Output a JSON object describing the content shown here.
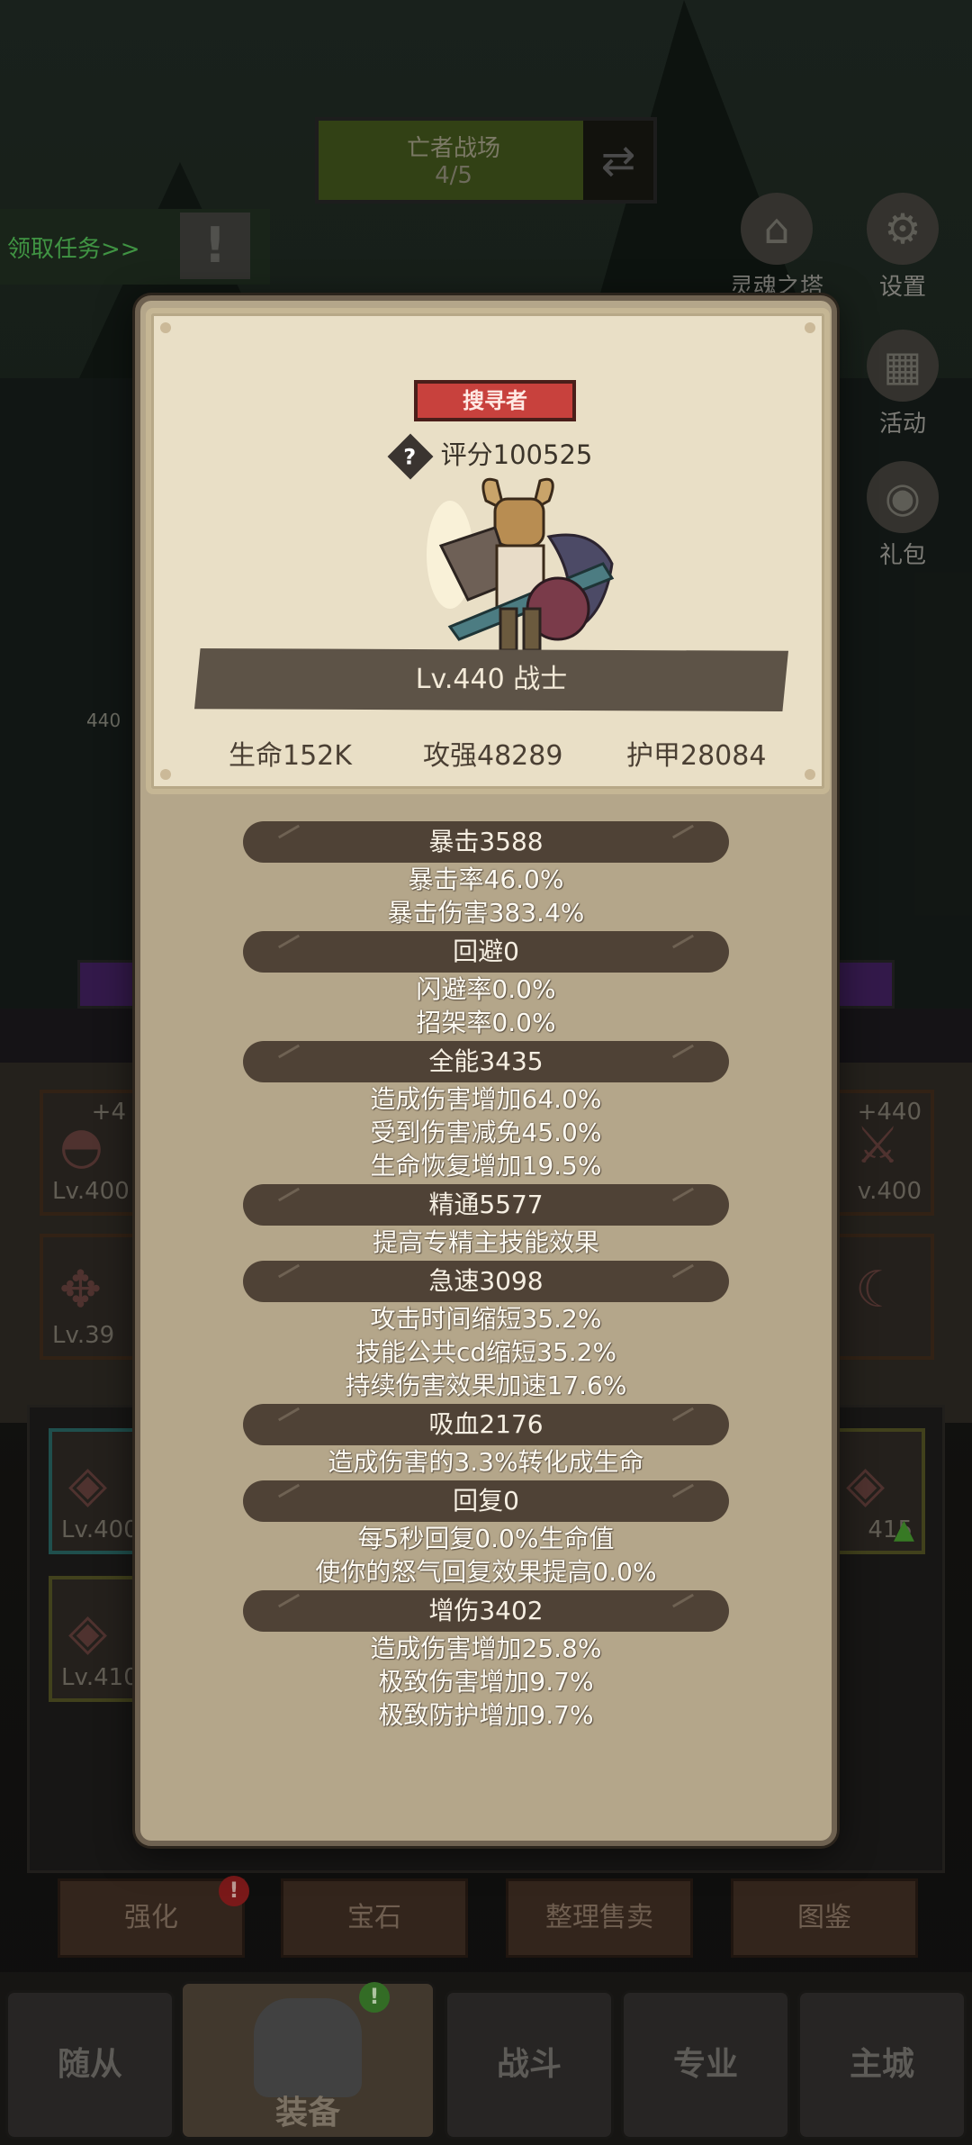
{
  "background": {
    "battle_title": "亡者战场",
    "battle_progress": "4/5",
    "quest_link": "领取任务>>",
    "side_buttons": [
      {
        "label": "灵魂之塔",
        "icon": "tower-icon"
      },
      {
        "label": "设置",
        "icon": "gear-icon"
      },
      {
        "label": "活动",
        "icon": "calendar-icon"
      },
      {
        "label": "礼包",
        "icon": "gift-icon"
      }
    ],
    "left_badge_level": "440",
    "equipment_left": [
      {
        "plus": "+4",
        "level": "Lv.400"
      },
      {
        "plus": "",
        "level": "Lv.39"
      }
    ],
    "equipment_right": [
      {
        "plus": "+440",
        "level": "v.400"
      }
    ],
    "bag_left": [
      {
        "level": "Lv.400"
      },
      {
        "level": "Lv.410"
      }
    ],
    "bag_right": [
      {
        "level": "415"
      }
    ],
    "actions": [
      {
        "label": "强化",
        "badge": "!"
      },
      {
        "label": "宝石"
      },
      {
        "label": "整理售卖"
      },
      {
        "label": "图鉴"
      }
    ],
    "tabs": [
      {
        "label": "随从"
      },
      {
        "label": "装备",
        "badge": "!"
      },
      {
        "label": "战斗"
      },
      {
        "label": "专业"
      },
      {
        "label": "主城"
      }
    ]
  },
  "dialog": {
    "class_tag": "搜寻者",
    "score": "评分100525",
    "level_class": "Lv.440 战士",
    "stats": {
      "hp": "生命152K",
      "attack": "攻强48289",
      "armor": "护甲28084"
    },
    "attributes": [
      {
        "name": "暴击3588",
        "details": [
          "暴击率46.0%",
          "暴击伤害383.4%"
        ]
      },
      {
        "name": "回避0",
        "details": [
          "闪避率0.0%",
          "招架率0.0%"
        ]
      },
      {
        "name": "全能3435",
        "details": [
          "造成伤害增加64.0%",
          "受到伤害减免45.0%",
          "生命恢复增加19.5%"
        ]
      },
      {
        "name": "精通5577",
        "details": [
          "提高专精主技能效果"
        ]
      },
      {
        "name": "急速3098",
        "details": [
          "攻击时间缩短35.2%",
          "技能公共cd缩短35.2%",
          "持续伤害效果加速17.6%"
        ]
      },
      {
        "name": "吸血2176",
        "details": [
          "造成伤害的3.3%转化成生命"
        ]
      },
      {
        "name": "回复0",
        "details": [
          "每5秒回复0.0%生命值",
          "使你的怒气回复效果提高0.0%"
        ]
      },
      {
        "name": "增伤3402",
        "details": [
          "造成伤害增加25.8%",
          "极致伤害增加9.7%",
          "极致防护增加9.7%"
        ]
      }
    ]
  }
}
